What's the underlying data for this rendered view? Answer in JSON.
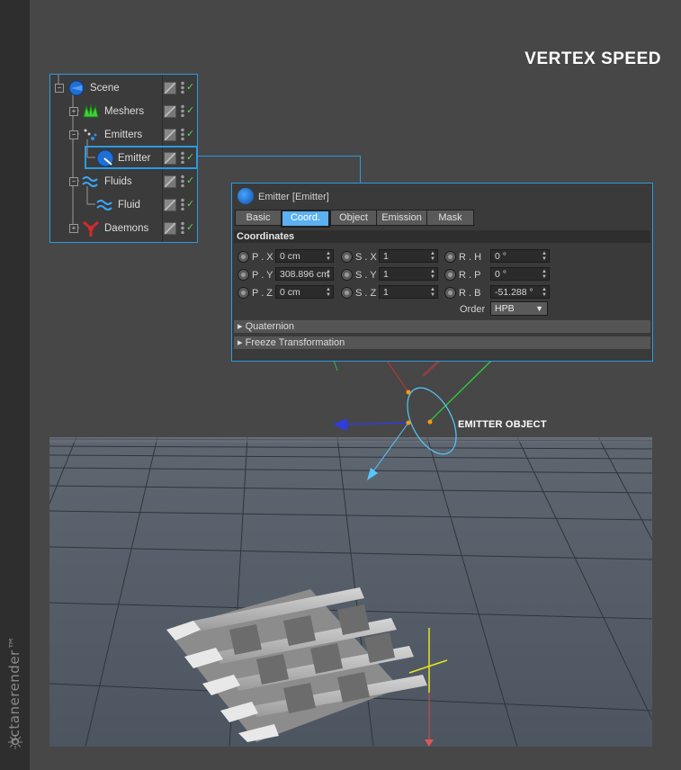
{
  "page_title": "VERTEX SPEED",
  "brand": {
    "name": "octanerender™",
    "logo_icon": "octane-logo-icon"
  },
  "object_manager": {
    "items": [
      {
        "label": "Scene",
        "icon": "scene-icon"
      },
      {
        "label": "Meshers",
        "icon": "meshers-icon"
      },
      {
        "label": "Emitters",
        "icon": "emitters-icon"
      },
      {
        "label": "Emitter",
        "icon": "emitter-icon",
        "selected": true
      },
      {
        "label": "Fluids",
        "icon": "fluids-icon"
      },
      {
        "label": "Fluid",
        "icon": "fluid-icon"
      },
      {
        "label": "Daemons",
        "icon": "daemons-icon"
      }
    ],
    "check_mark": "✓"
  },
  "attributes": {
    "title": "Emitter [Emitter]",
    "tabs": [
      "Basic",
      "Coord.",
      "Object",
      "Emission",
      "Mask"
    ],
    "active_tab": "Coord.",
    "section": "Coordinates",
    "position": [
      {
        "label": "P . X",
        "value": "0 cm"
      },
      {
        "label": "P . Y",
        "value": "308.896 cm"
      },
      {
        "label": "P . Z",
        "value": "0 cm"
      }
    ],
    "scale": [
      {
        "label": "S . X",
        "value": "1"
      },
      {
        "label": "S . Y",
        "value": "1"
      },
      {
        "label": "S . Z",
        "value": "1"
      }
    ],
    "rotation": [
      {
        "label": "R . H",
        "value": "0 °"
      },
      {
        "label": "R . P",
        "value": "0 °"
      },
      {
        "label": "R . B",
        "value": "-51.288 °"
      }
    ],
    "order_label": "Order",
    "order_value": "HPB",
    "groups": [
      "Quaternion",
      "Freeze Transformation"
    ]
  },
  "viewport": {
    "annotation": "EMITTER OBJECT",
    "colors": {
      "floor": "#4f5862",
      "grid": "#2d333a",
      "axis_x": "#e8302a",
      "axis_y": "#29d93a",
      "axis_z": "#2f3ce0",
      "emitter_ring": "#55c7ff",
      "accent": "#2a9be0"
    }
  }
}
